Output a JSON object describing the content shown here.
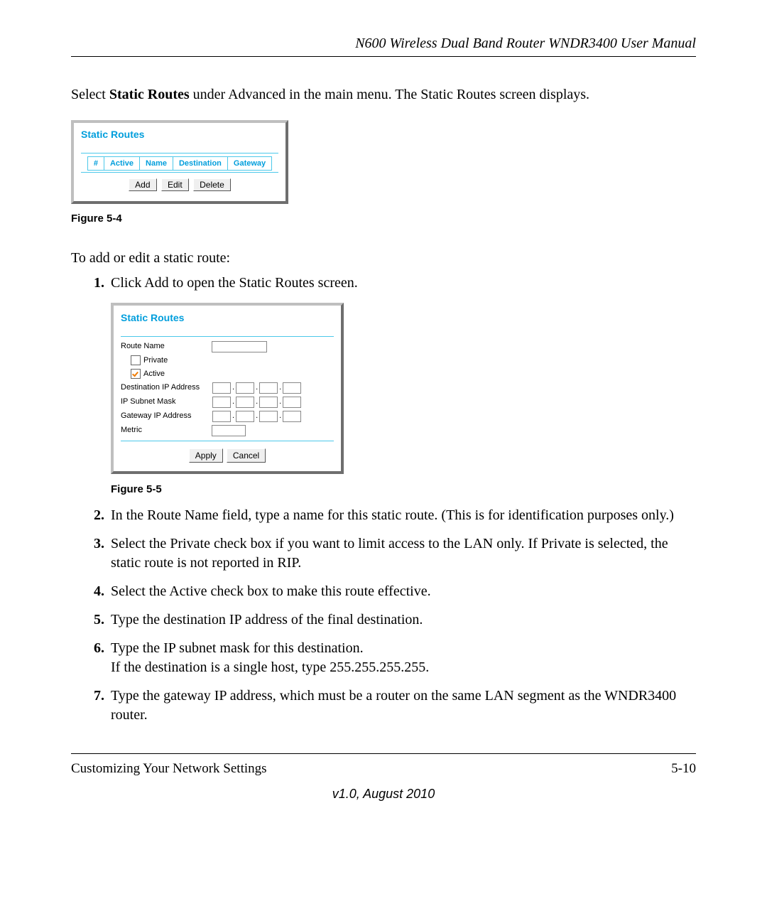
{
  "header": {
    "title": "N600 Wireless Dual Band Router WNDR3400 User Manual"
  },
  "intro": {
    "pre": "Select ",
    "bold": "Static Routes",
    "post": " under Advanced in the main menu. The Static Routes screen displays."
  },
  "fig1": {
    "title": "Static Routes",
    "columns": [
      "#",
      "Active",
      "Name",
      "Destination",
      "Gateway"
    ],
    "buttons": {
      "add": "Add",
      "edit": "Edit",
      "delete": "Delete"
    },
    "caption": "Figure 5-4"
  },
  "intro2": "To add or edit a static route:",
  "steps": [
    {
      "num": 1,
      "pre": "Click ",
      "bold": "Add",
      "post": " to open the Static Routes screen."
    },
    {
      "num": 2,
      "pre": "In the ",
      "bold": "Route Name",
      "post": " field, type a name for this static route. (This is for identification purposes only.)"
    },
    {
      "num": 3,
      "pre": "Select the ",
      "bold": "Private",
      "post": " check box if you want to limit access to the LAN only. If Private is selected, the static route is not reported in RIP."
    },
    {
      "num": 4,
      "pre": "Select the ",
      "bold": "Active",
      "post": " check box to make this route effective."
    },
    {
      "num": 5,
      "plain": "Type the destination IP address of the final destination."
    },
    {
      "num": 6,
      "plain": "Type the IP subnet mask for this destination.\nIf the destination is a single host, type 255.255.255.255."
    },
    {
      "num": 7,
      "plain": "Type the gateway IP address, which must be a router on the same LAN segment as the WNDR3400 router."
    }
  ],
  "fig2": {
    "title": "Static Routes",
    "labels": {
      "routeName": "Route Name",
      "private": "Private",
      "active": "Active",
      "destIp": "Destination IP Address",
      "subnet": "IP Subnet Mask",
      "gateway": "Gateway IP Address",
      "metric": "Metric"
    },
    "buttons": {
      "apply": "Apply",
      "cancel": "Cancel"
    },
    "caption": "Figure 5-5"
  },
  "footer": {
    "left": "Customizing Your Network Settings",
    "right": "5-10",
    "center": "v1.0, August 2010"
  }
}
